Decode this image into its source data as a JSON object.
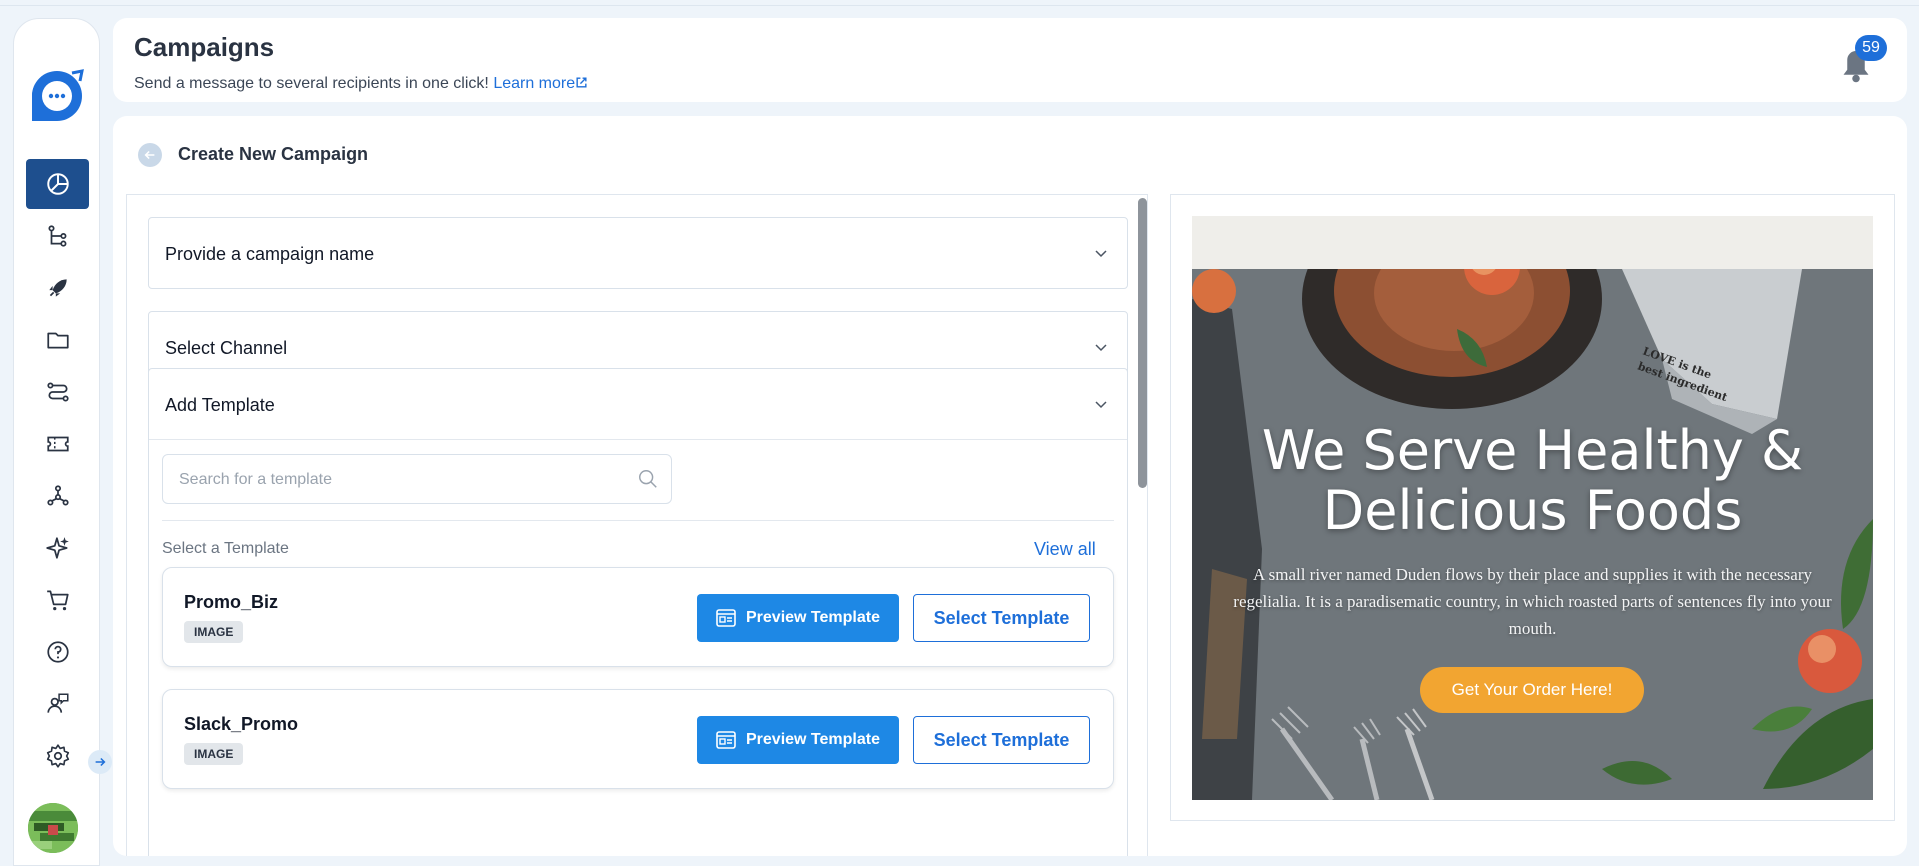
{
  "header": {
    "title": "Campaigns",
    "subtitle": "Send a message to several recipients in one click!",
    "learn_more": "Learn more",
    "notification_count": "59"
  },
  "sidebar": {
    "items": [
      {
        "icon": "dashboard-pie-icon",
        "active": true
      },
      {
        "icon": "flow-tree-icon"
      },
      {
        "icon": "rocket-icon"
      },
      {
        "icon": "folder-icon"
      },
      {
        "icon": "route-icon"
      },
      {
        "icon": "ticket-icon"
      },
      {
        "icon": "integrations-icon"
      },
      {
        "icon": "sparkles-icon"
      },
      {
        "icon": "cart-icon"
      },
      {
        "icon": "help-icon"
      },
      {
        "icon": "support-agent-icon"
      },
      {
        "icon": "settings-gear-icon"
      }
    ]
  },
  "main": {
    "section_title": "Create New Campaign",
    "accordions": {
      "name": "Provide a campaign name",
      "channel": "Select Channel",
      "template": "Add Template"
    },
    "search": {
      "placeholder": "Search for a template"
    },
    "select_label": "Select a Template",
    "view_all": "View all",
    "templates": [
      {
        "name": "Promo_Biz",
        "type": "IMAGE",
        "preview_label": "Preview Template",
        "select_label": "Select Template"
      },
      {
        "name": "Slack_Promo",
        "type": "IMAGE",
        "preview_label": "Preview Template",
        "select_label": "Select Template"
      }
    ]
  },
  "preview": {
    "title": "We Serve Healthy & Delicious Foods",
    "body": "A small river named Duden flows by their place and supplies it with the necessary regelialia. It is a paradisematic country, in which roasted parts of sentences fly into your mouth.",
    "cta": "Get Your Order Here!",
    "napkin_text": "LOVE is the best ingredient"
  },
  "colors": {
    "accent": "#1e6fd9",
    "sidebar_active": "#1e4f8e",
    "cta": "#f2a531"
  }
}
